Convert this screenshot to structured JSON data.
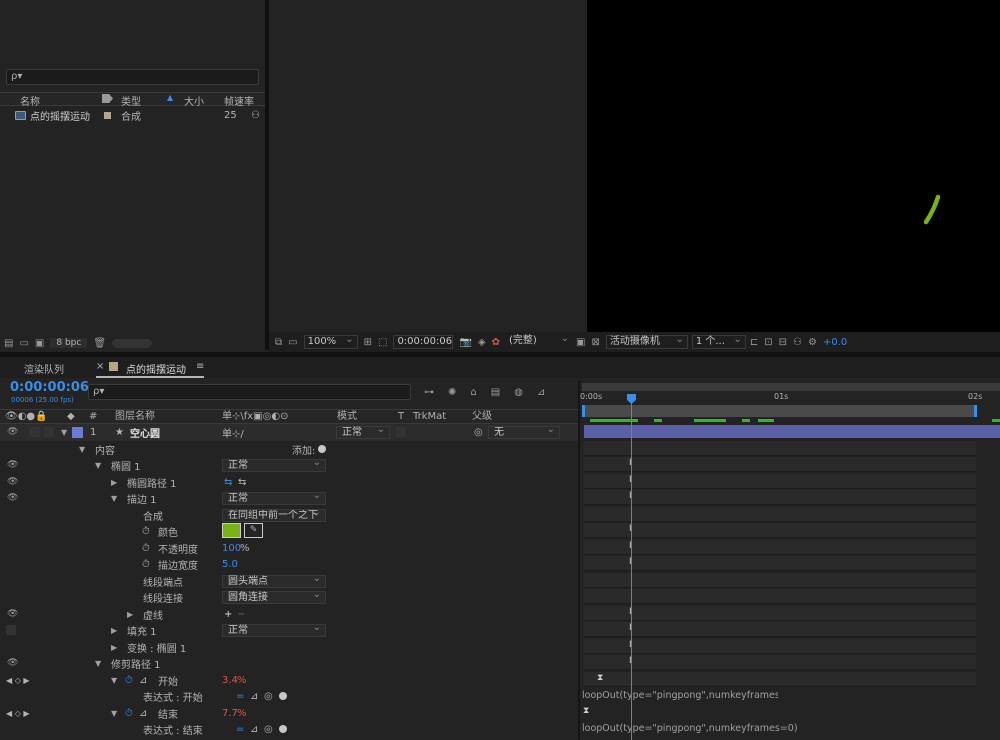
{
  "project": {
    "search_placeholder": "ρ▾",
    "col_name": "名称",
    "col_type": "类型",
    "col_size": "大小",
    "col_fps": "帧速率",
    "item": {
      "name": "点的摇摆运动",
      "type": "合成",
      "fps": "25"
    },
    "bpc": "8 bpc"
  },
  "viewer": {
    "zoom": "100%",
    "timecode": "0:00:00:06",
    "resolution": "(完整)",
    "camera": "活动摄像机",
    "views": "1 个...",
    "exposure": "+0.0"
  },
  "timeline": {
    "tab_render": "渲染队列",
    "tab_comp": "点的摇摆运动",
    "menu_icon": "≡",
    "timecode": "0:00:00:06",
    "subframe": "00006 (25.00 fps)",
    "search_placeholder": "ρ▾",
    "header": {
      "num": "#",
      "layer_name": "图层名称",
      "switches": "单⊹\\fx▣◎◐⊙",
      "mode": "模式",
      "t": "T",
      "trkmat": "TrkMat",
      "parent": "父级"
    },
    "ruler": {
      "t0": "0:00s",
      "t1": "01s",
      "t2": "02s"
    },
    "layer": {
      "num": "1",
      "star": "★",
      "name": "空心圆",
      "sw": "单⊹/",
      "mode": "正常",
      "parent_icon": "◎",
      "parent": "无"
    },
    "rows": {
      "contents": "内容",
      "add": "添加:",
      "ellipse": "椭圆 1",
      "ellipse_mode": "正常",
      "ellipse_path": "椭圆路径 1",
      "stroke": "描边 1",
      "stroke_mode": "正常",
      "composite": "合成",
      "composite_val": "在同组中前一个之下",
      "color": "颜色",
      "opacity": "不透明度",
      "opacity_val": "100",
      "pct": "%",
      "width": "描边宽度",
      "width_val": "5.0",
      "cap": "线段端点",
      "cap_val": "圆头端点",
      "join": "线段连接",
      "join_val": "圆角连接",
      "dashes": "虚线",
      "fill": "填充 1",
      "fill_mode": "正常",
      "transform": "变换 : 椭圆 1",
      "trim": "修剪路径 1",
      "start": "开始",
      "start_val": "3.4",
      "expr_start": "表达式 : 开始",
      "end": "结束",
      "end_val": "7.7",
      "expr_end": "表达式 : 结束"
    },
    "expr_start_code": "loopOut(type=\"pingpong\",numkeyframes=",
    "expr_end_code": "loopOut(type=\"pingpong\",numkeyframes=0)"
  },
  "colors": {
    "accent_blue": "#3a8ee6",
    "stroke_green": "#7ab317",
    "layer_label": "#6f79d6",
    "value_red": "#d9534f"
  }
}
